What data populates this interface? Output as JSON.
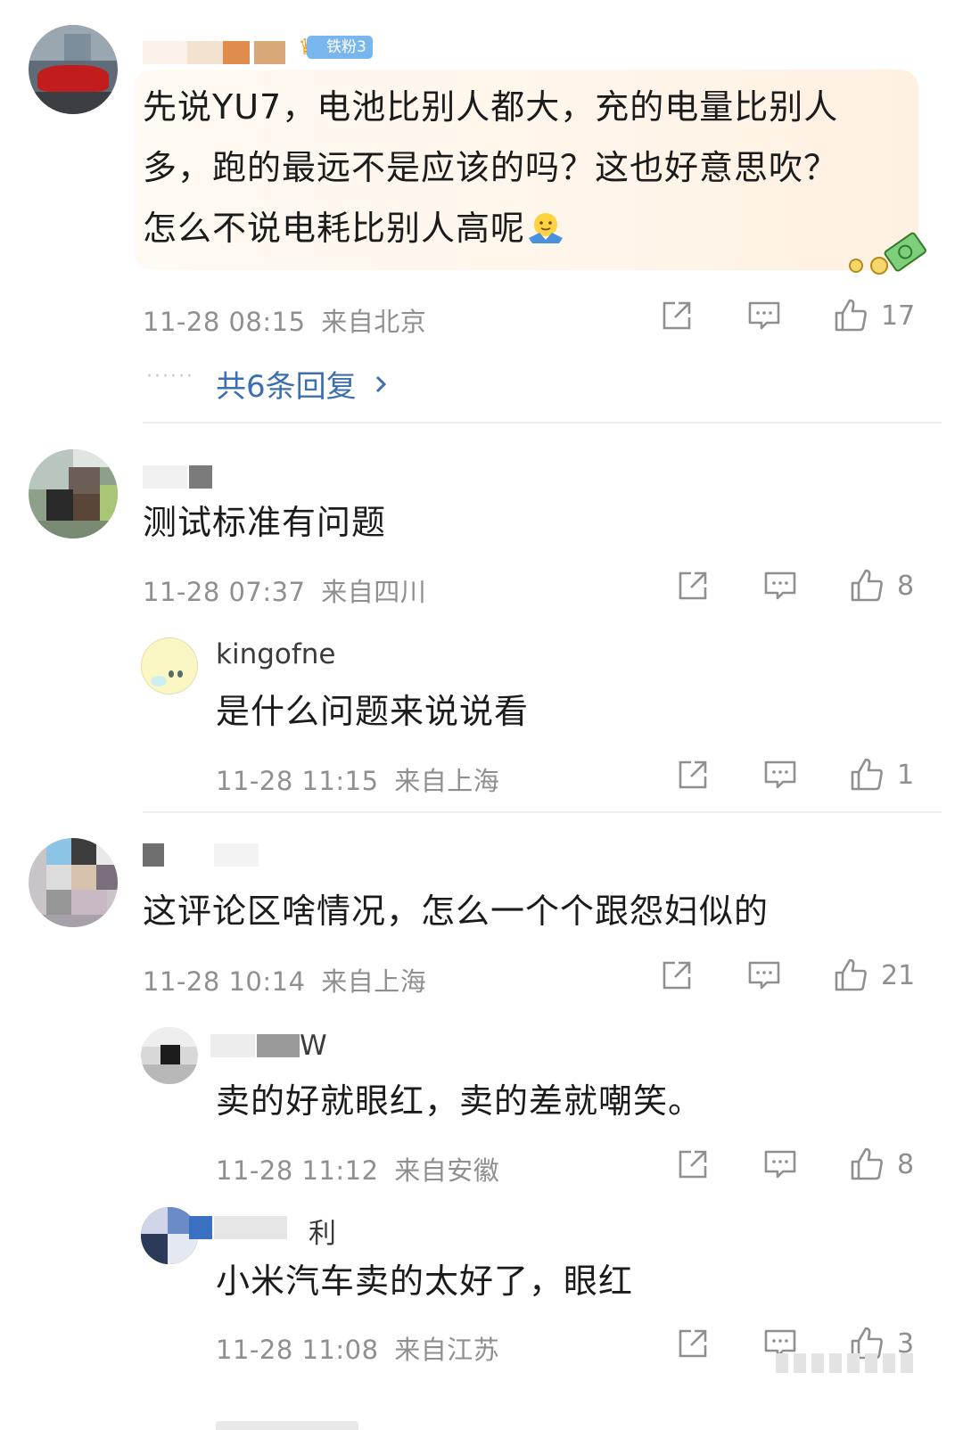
{
  "comments": [
    {
      "badge": "铁粉3",
      "text": "先说YU7，电池比别人都大，充的电量比别人多，跑的最远不是应该的吗？这也好意思吹？怎么不说电耗比别人高呢",
      "lines": [
        "先说YU7，电池比别人都大，充的电量比别人",
        "多，跑的最远不是应该的吗？这也好意思吹？",
        "怎么不说电耗比别人高呢"
      ],
      "time": "11-28 08:15",
      "location": "来自北京",
      "likes": "17",
      "reply_summary": "共6条回复"
    },
    {
      "text": "测试标准有问题",
      "time": "11-28 07:37",
      "location": "来自四川",
      "likes": "8",
      "replies": [
        {
          "username": "kingofne",
          "text": "是什么问题来说说看",
          "time": "11-28 11:15",
          "location": "来自上海",
          "likes": "1"
        }
      ]
    },
    {
      "text": "这评论区啥情况，怎么一个个跟怨妇似的",
      "time": "11-28 10:14",
      "location": "来自上海",
      "likes": "21",
      "replies": [
        {
          "username_visible": "W",
          "text": "卖的好就眼红，卖的差就嘲笑。",
          "time": "11-28 11:12",
          "location": "来自安徽",
          "likes": "8"
        },
        {
          "username_visible": "利",
          "text": "小米汽车卖的太好了，眼红",
          "time": "11-28 11:08",
          "location": "来自江苏",
          "likes": "3"
        }
      ]
    }
  ],
  "icons": {
    "share": "share-icon",
    "comment": "comment-icon",
    "like": "thumbs-up-icon",
    "chevron": "chevron-right-icon"
  },
  "colors": {
    "link": "#3d6fb0",
    "meta": "#8f8f8f",
    "badge": "#7ab6ee"
  }
}
